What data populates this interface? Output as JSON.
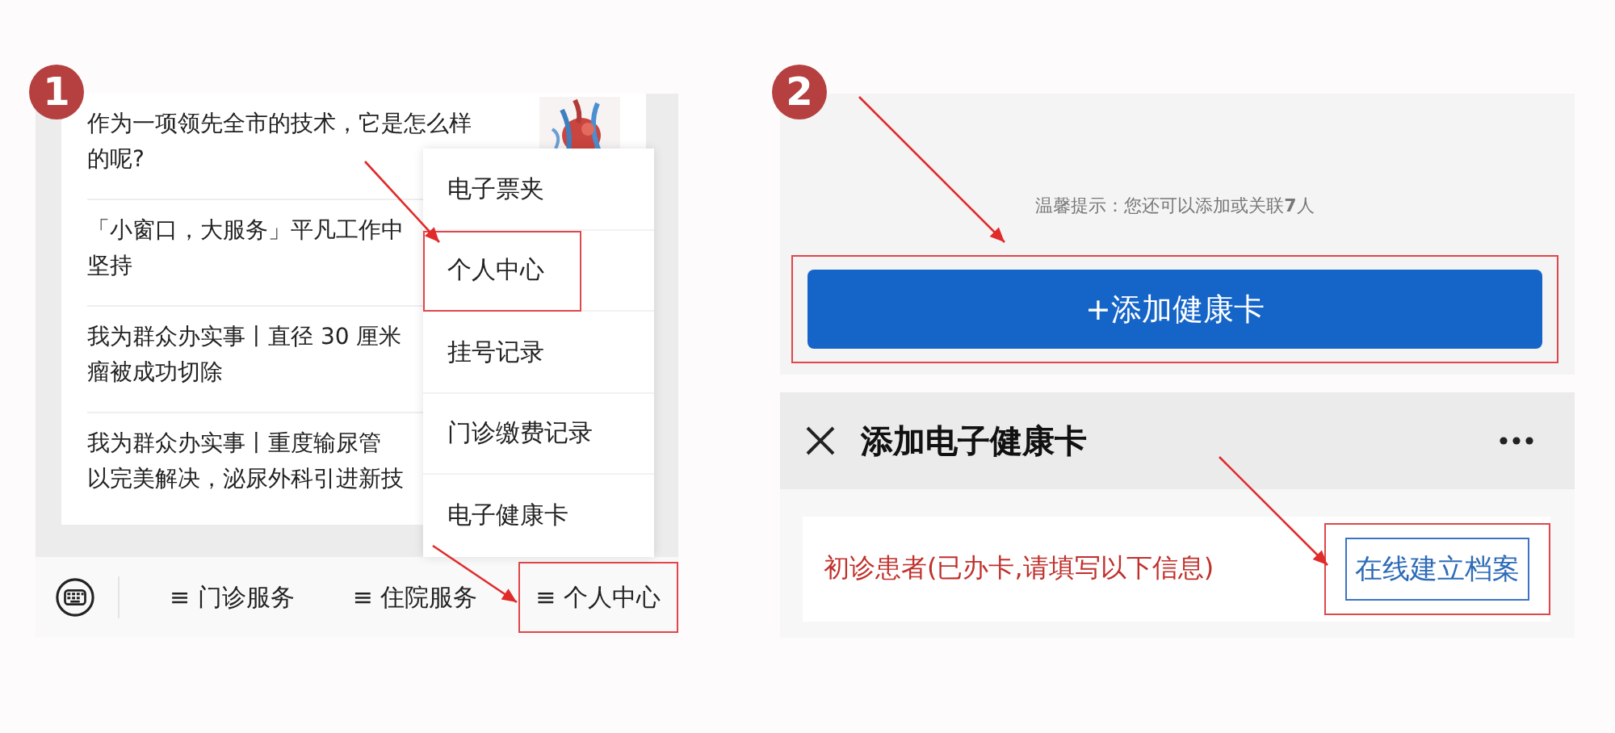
{
  "steps": [
    {
      "number": "1"
    },
    {
      "number": "2"
    }
  ],
  "left_screen": {
    "articles": [
      {
        "title_lines": [
          "作为一项领先全市的技术，它是怎么样",
          "的呢?"
        ],
        "kind": "picture"
      },
      {
        "title_lines": [
          "「小窗口，大服务」平凡工作中",
          "坚持"
        ]
      },
      {
        "title_lines": [
          "我为群众办实事丨直径 30 厘米",
          "瘤被成功切除"
        ]
      },
      {
        "title_lines": [
          "我为群众办实事丨重度输尿管",
          "以完美解决，泌尿外科引进新技"
        ]
      }
    ],
    "menu": [
      {
        "label": "电子票夹",
        "highlighted": false
      },
      {
        "label": "个人中心",
        "highlighted": true
      },
      {
        "label": "挂号记录",
        "highlighted": false
      },
      {
        "label": "门诊缴费记录",
        "highlighted": false
      },
      {
        "label": "电子健康卡",
        "highlighted": false
      }
    ],
    "bottom_tabs": [
      {
        "label": "≡ 门诊服务",
        "highlighted": false
      },
      {
        "label": "≡ 住院服务",
        "highlighted": false
      },
      {
        "label": "≡ 个人中心",
        "highlighted": true
      }
    ]
  },
  "right_screen": {
    "hint": "温馨提示：您还可以添加或关联**7**人",
    "add_button": {
      "label": "+添加健康卡",
      "highlighted": true
    },
    "header": {
      "title": "添加电子健康卡"
    },
    "notice": "初诊患者(已办卡,请填写以下信息)",
    "create_button": {
      "label": "在线建立档案",
      "highlighted": true
    }
  }
}
